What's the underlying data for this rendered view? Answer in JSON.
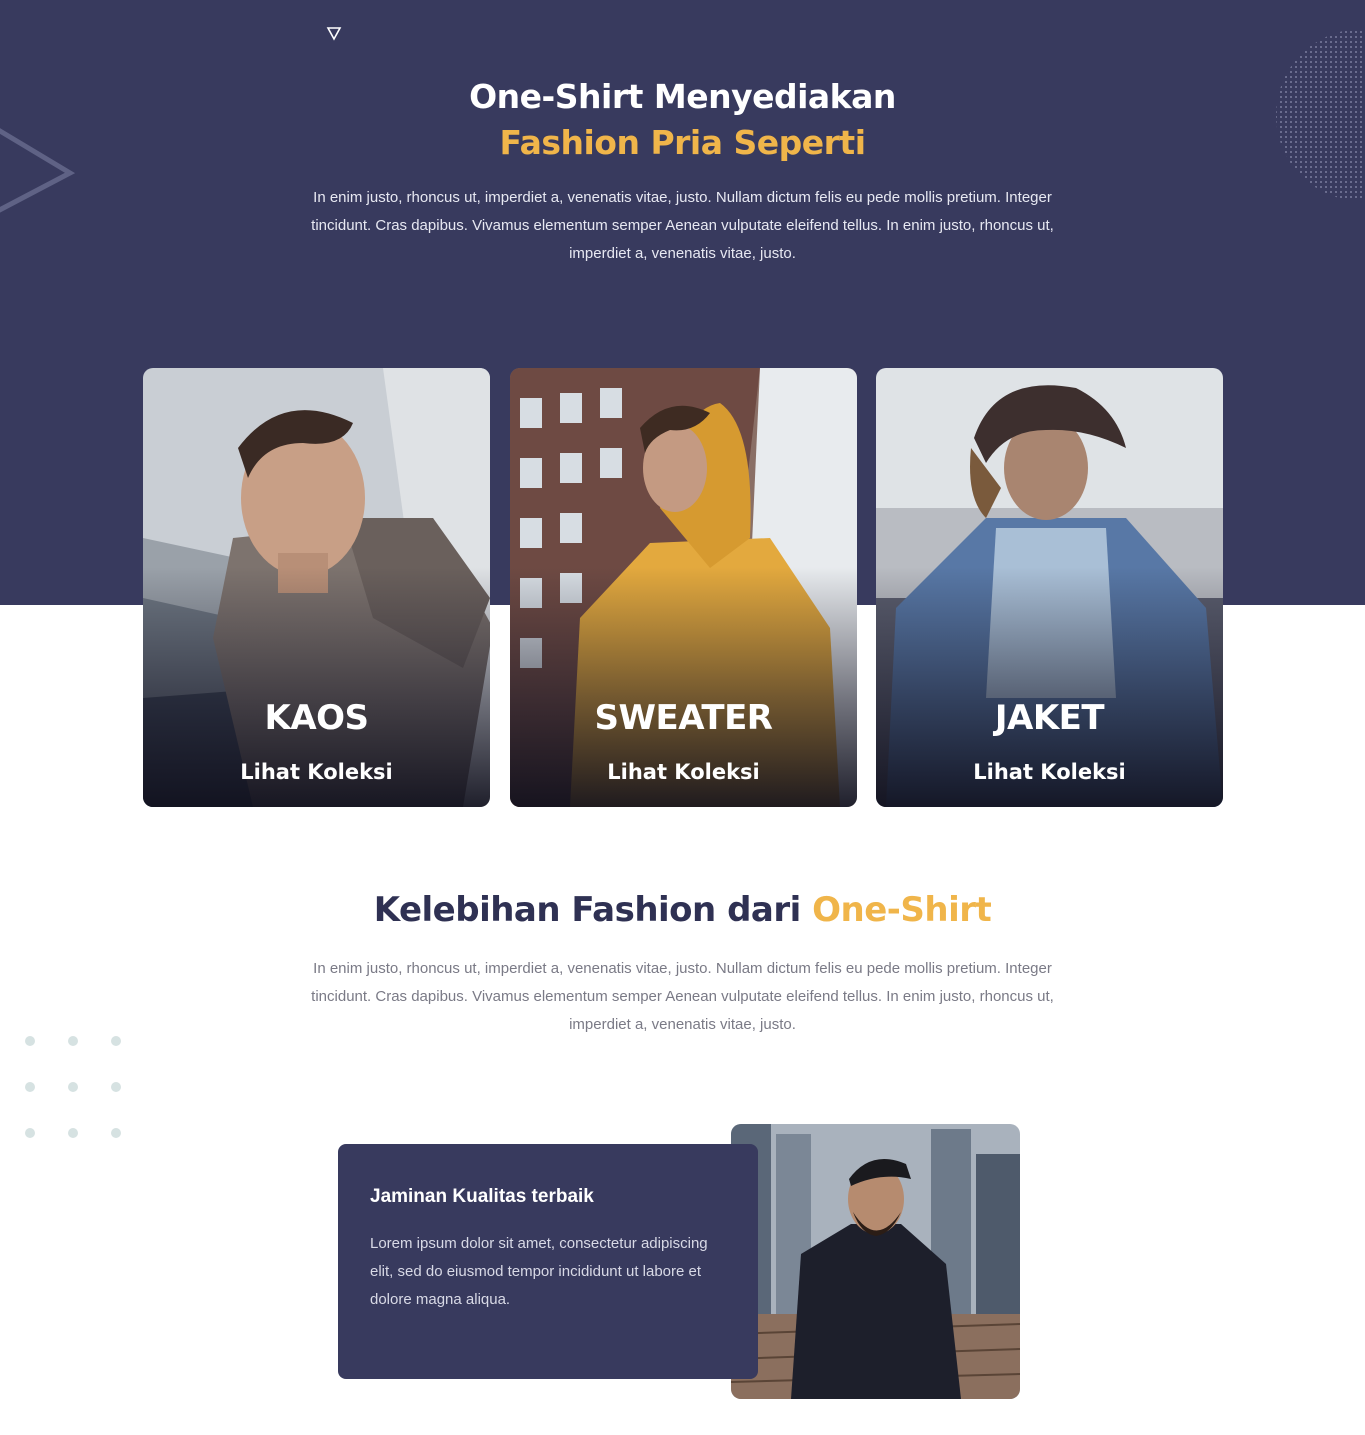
{
  "colors": {
    "primary_dark": "#383a5e",
    "accent": "#f0b54a",
    "white": "#ffffff"
  },
  "hero": {
    "title_line1": "One-Shirt Menyediakan",
    "title_line2": "Fashion Pria Seperti",
    "description": "In enim justo, rhoncus ut, imperdiet a, venenatis vitae, justo. Nullam dictum felis eu pede mollis pretium. Integer tincidunt. Cras dapibus. Vivamus elementum semper Aenean vulputate eleifend tellus. In enim justo, rhoncus ut, imperdiet a, venenatis vitae, justo."
  },
  "categories": [
    {
      "title": "KAOS",
      "link_label": "Lihat Koleksi"
    },
    {
      "title": "SWEATER",
      "link_label": "Lihat Koleksi"
    },
    {
      "title": "JAKET",
      "link_label": "Lihat Koleksi"
    }
  ],
  "advantages": {
    "title_main": "Kelebihan Fashion dari ",
    "title_accent": "One-Shirt",
    "description": "In enim justo, rhoncus ut, imperdiet a, venenatis vitae, justo. Nullam dictum felis eu pede mollis pretium. Integer tincidunt. Cras dapibus. Vivamus elementum semper Aenean vulputate eleifend tellus. In enim justo, rhoncus ut, imperdiet a, venenatis vitae, justo."
  },
  "feature": {
    "title": "Jaminan Kualitas terbaik",
    "text": "Lorem ipsum dolor sit amet, consectetur adipiscing elit, sed do eiusmod tempor incididunt ut labore et dolore magna aliqua."
  },
  "icons": {
    "small_triangle": "triangle-down-icon",
    "big_triangle": "triangle-outline-icon",
    "dot_circle": "dotted-circle-decoration",
    "dot_grid": "dot-grid-decoration"
  }
}
